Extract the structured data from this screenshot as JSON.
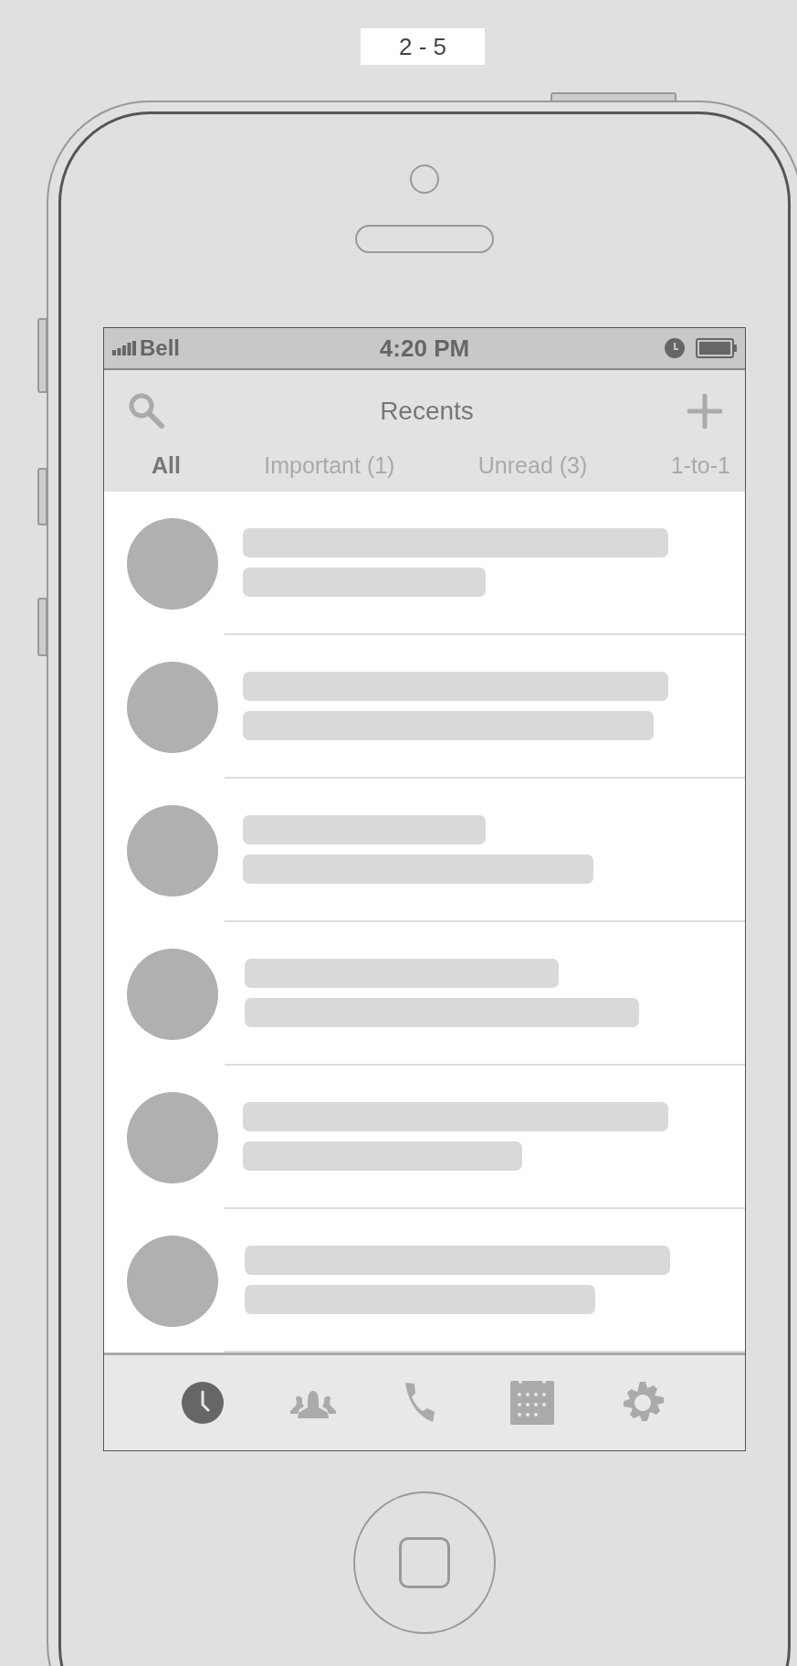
{
  "page_label": "2 - 5",
  "status_bar": {
    "carrier": "Bell",
    "time": "4:20 PM"
  },
  "header": {
    "title": "Recents"
  },
  "filter_tabs": [
    {
      "label": "All",
      "selected": true
    },
    {
      "label": "Important (1)",
      "selected": false
    },
    {
      "label": "Unread (3)",
      "selected": false
    },
    {
      "label": "1-to-1",
      "selected": false
    }
  ],
  "conversations": [
    {
      "kind": "placeholder"
    },
    {
      "kind": "placeholder"
    },
    {
      "kind": "placeholder"
    },
    {
      "kind": "placeholder"
    },
    {
      "kind": "placeholder"
    },
    {
      "kind": "placeholder"
    }
  ],
  "tab_bar": [
    {
      "kind": "recents",
      "selected": true
    },
    {
      "kind": "contacts",
      "selected": false
    },
    {
      "kind": "calls",
      "selected": false
    },
    {
      "kind": "calendar",
      "selected": false
    },
    {
      "kind": "settings",
      "selected": false
    }
  ]
}
